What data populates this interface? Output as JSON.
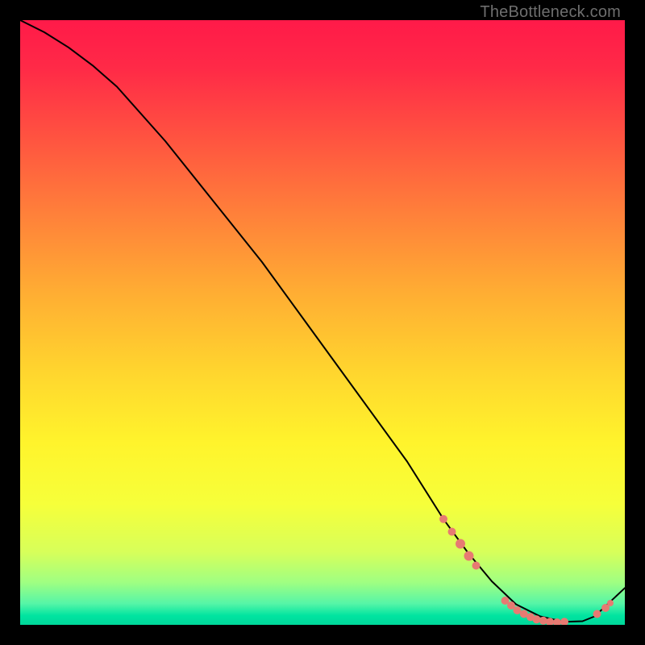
{
  "watermark": "TheBottleneck.com",
  "chart_data": {
    "type": "line",
    "title": "",
    "xlabel": "",
    "ylabel": "",
    "xlim": [
      0,
      100
    ],
    "ylim": [
      0,
      100
    ],
    "grid": false,
    "legend": false,
    "series": [
      {
        "name": "curve",
        "stroke": "#000000",
        "x": [
          0,
          4,
          8,
          12,
          16,
          24,
          32,
          40,
          48,
          56,
          64,
          70,
          74,
          78,
          82,
          86,
          90,
          93,
          95,
          100
        ],
        "y": [
          100,
          98,
          95.5,
          92.5,
          89,
          80,
          70,
          60,
          49,
          38,
          27,
          17.5,
          12,
          7.2,
          3.4,
          1.4,
          0.5,
          0.6,
          1.4,
          6.1
        ]
      }
    ],
    "markers": {
      "color": "#e77a72",
      "points": [
        {
          "x": 70.0,
          "y": 17.5,
          "r": 5
        },
        {
          "x": 71.4,
          "y": 15.4,
          "r": 5
        },
        {
          "x": 72.8,
          "y": 13.4,
          "r": 6
        },
        {
          "x": 74.2,
          "y": 11.4,
          "r": 6
        },
        {
          "x": 75.4,
          "y": 9.8,
          "r": 5
        },
        {
          "x": 80.2,
          "y": 4.0,
          "r": 5
        },
        {
          "x": 81.2,
          "y": 3.2,
          "r": 5
        },
        {
          "x": 82.2,
          "y": 2.4,
          "r": 5
        },
        {
          "x": 83.3,
          "y": 1.8,
          "r": 5
        },
        {
          "x": 84.4,
          "y": 1.3,
          "r": 5
        },
        {
          "x": 85.4,
          "y": 0.9,
          "r": 5
        },
        {
          "x": 86.5,
          "y": 0.7,
          "r": 5
        },
        {
          "x": 87.6,
          "y": 0.5,
          "r": 5
        },
        {
          "x": 88.8,
          "y": 0.4,
          "r": 5
        },
        {
          "x": 90.0,
          "y": 0.5,
          "r": 5
        },
        {
          "x": 95.4,
          "y": 1.8,
          "r": 5
        },
        {
          "x": 96.8,
          "y": 2.8,
          "r": 5
        },
        {
          "x": 97.6,
          "y": 3.6,
          "r": 4
        }
      ]
    }
  }
}
